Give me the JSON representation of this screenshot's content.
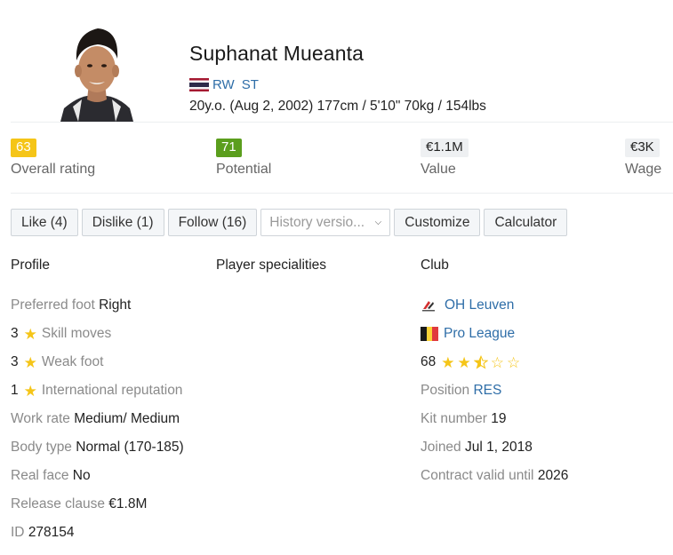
{
  "player": {
    "name": "Suphanat Mueanta",
    "positions": [
      "RW",
      "ST"
    ],
    "bio": "20y.o. (Aug 2, 2002) 177cm / 5'10\" 70kg / 154lbs"
  },
  "stats": [
    {
      "value": "63",
      "label": "Overall rating",
      "color": "#f5c518"
    },
    {
      "value": "71",
      "label": "Potential",
      "color": "#5b9e1d"
    },
    {
      "value": "€1.1M",
      "label": "Value"
    },
    {
      "value": "€3K",
      "label": "Wage"
    }
  ],
  "actions": {
    "like": "Like (4)",
    "dislike": "Dislike (1)",
    "follow": "Follow (16)",
    "history_placeholder": "History versio...",
    "customize": "Customize",
    "calculator": "Calculator"
  },
  "sections": {
    "profile": "Profile",
    "specialities": "Player specialities",
    "club": "Club"
  },
  "profile": {
    "preferred_foot": {
      "label": "Preferred foot",
      "value": "Right"
    },
    "skill_moves": {
      "value": "3",
      "label": "Skill moves"
    },
    "weak_foot": {
      "value": "3",
      "label": "Weak foot"
    },
    "intl_rep": {
      "value": "1",
      "label": "International reputation"
    },
    "work_rate": {
      "label": "Work rate",
      "value": "Medium/ Medium"
    },
    "body_type": {
      "label": "Body type",
      "value": "Normal (170-185)"
    },
    "real_face": {
      "label": "Real face",
      "value": "No"
    },
    "release_clause": {
      "label": "Release clause",
      "value": "€1.8M"
    },
    "id": {
      "label": "ID",
      "value": "278154"
    }
  },
  "club": {
    "name": "OH Leuven",
    "league": "Pro League",
    "rating": "68",
    "rating_stars": 2.5,
    "rating_max": 5,
    "position": {
      "label": "Position",
      "value": "RES"
    },
    "kit_number": {
      "label": "Kit number",
      "value": "19"
    },
    "joined": {
      "label": "Joined",
      "value": "Jul 1, 2018"
    },
    "contract": {
      "label": "Contract valid until",
      "value": "2026"
    }
  },
  "colors": {
    "link": "#2f6ea8",
    "star": "#f5c518"
  },
  "icons": {
    "star": "star-icon",
    "caret": "chevron-down-icon"
  }
}
